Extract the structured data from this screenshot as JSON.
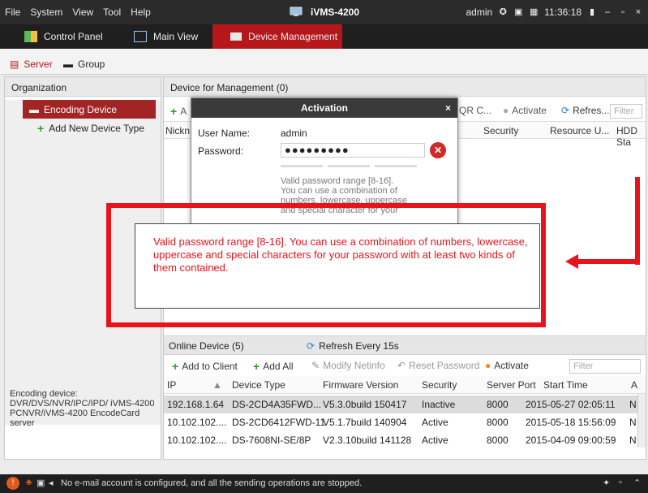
{
  "titlebar": {
    "menu": [
      "File",
      "System",
      "View",
      "Tool",
      "Help"
    ],
    "app_title": "iVMS-4200",
    "user": "admin",
    "time": "11:36:18"
  },
  "tabs": [
    {
      "label": "Control Panel"
    },
    {
      "label": "Main View"
    },
    {
      "label": "Device Management"
    }
  ],
  "subtabs": [
    {
      "label": "Server"
    },
    {
      "label": "Group"
    }
  ],
  "org": {
    "header": "Organization",
    "items": [
      {
        "label": "Encoding Device"
      },
      {
        "label": "Add New Device Type"
      }
    ],
    "description": "Encoding device: DVR/DVS/NVR/IPC/IPD/ iVMS-4200 PCNVR/iVMS-4200 EncodeCard server"
  },
  "device_panel": {
    "header": "Device for Management (0)",
    "toolbar": {
      "add_label": "A",
      "qr_label": "QR C...",
      "activate_label": "Activate",
      "refresh_label": "Refres...",
      "filter_placeholder": "Filter"
    },
    "columns": [
      "Nickn",
      "Security",
      "Resource U...",
      "HDD Sta"
    ]
  },
  "online": {
    "title": "Online Device (5)",
    "refresh": "Refresh Every 15s",
    "toolbar": {
      "add_to_client": "Add to Client",
      "add_all": "Add All",
      "modify_netinfo": "Modify Netinfo",
      "reset_password": "Reset Password",
      "activate": "Activate",
      "filter_placeholder": "Filter"
    },
    "columns": [
      "IP",
      "Device Type",
      "Firmware Version",
      "Security",
      "Server Port",
      "Start Time",
      "A"
    ],
    "rows": [
      [
        "192.168.1.64",
        "DS-2CD4A35FWD...",
        "V5.3.0build 150417",
        "Inactive",
        "8000",
        "2015-05-27 02:05:11",
        "N"
      ],
      [
        "10.102.102....",
        "DS-2CD6412FWD-11",
        "V5.1.7build 140904",
        "Active",
        "8000",
        "2015-05-18 15:56:09",
        "N"
      ],
      [
        "10.102.102....",
        "DS-7608NI-SE/8P",
        "V2.3.10build 141128",
        "Active",
        "8000",
        "2015-04-09 09:00:59",
        "N"
      ]
    ]
  },
  "dialog": {
    "title": "Activation",
    "close": "×",
    "username_label": "User Name:",
    "username_value": "admin",
    "password_label": "Password:",
    "password_value": "●●●●●●●●●",
    "hint": "Valid password range [8-16]. You can use a combination of numbers, lowercase, uppercase and special character for your"
  },
  "callout": {
    "text": "Valid password range [8-16]. You can use a combination of numbers, lowercase, uppercase and special characters for your password with at least two kinds of them contained.",
    "color": "#e8141c"
  },
  "statusbar": {
    "message": "No e-mail account is configured, and all the sending operations are stopped."
  },
  "colors": {
    "accent": "#b5171b",
    "dark": "#1f1f1f",
    "callout": "#e8141c"
  }
}
